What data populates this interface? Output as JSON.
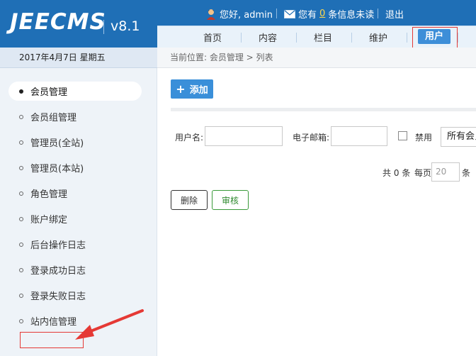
{
  "app": {
    "logo": "JEECMS",
    "version": "v8.1"
  },
  "userbar": {
    "greeting": "您好, admin",
    "msg_prefix": "您有",
    "msg_count": "0",
    "msg_suffix": "条信息未读",
    "logout": "退出"
  },
  "nav": {
    "items": [
      {
        "label": "首页"
      },
      {
        "label": "内容"
      },
      {
        "label": "栏目"
      },
      {
        "label": "维护"
      },
      {
        "label": "用户"
      }
    ],
    "active_index": 4
  },
  "date": "2017年4月7日 星期五",
  "breadcrumb": "当前位置: 会员管理 > 列表",
  "sidebar": {
    "items": [
      {
        "label": "会员管理"
      },
      {
        "label": "会员组管理"
      },
      {
        "label": "管理员(全站)"
      },
      {
        "label": "管理员(本站)"
      },
      {
        "label": "角色管理"
      },
      {
        "label": "账户绑定"
      },
      {
        "label": "后台操作日志"
      },
      {
        "label": "登录成功日志"
      },
      {
        "label": "登录失败日志"
      },
      {
        "label": "站内信管理"
      }
    ],
    "active_index": 0
  },
  "toolbar": {
    "add_label": "添加"
  },
  "filter": {
    "username_label": "用户名:",
    "username_value": "",
    "email_label": "电子邮箱:",
    "email_value": "",
    "disabled_label": "禁用",
    "disabled_checked": false,
    "group_select_value": "所有会员组"
  },
  "pager": {
    "total_prefix": "共",
    "total": "0",
    "total_suffix": "条",
    "per_page_label": "每页",
    "page_size": "20",
    "page_size_suffix": "条"
  },
  "actions": {
    "delete_label": "删除",
    "audit_label": "审核"
  },
  "colors": {
    "header": "#1f6fb6",
    "accent": "#3a8fd9",
    "annotation": "#e53935",
    "audit": "#2f8a2f"
  }
}
